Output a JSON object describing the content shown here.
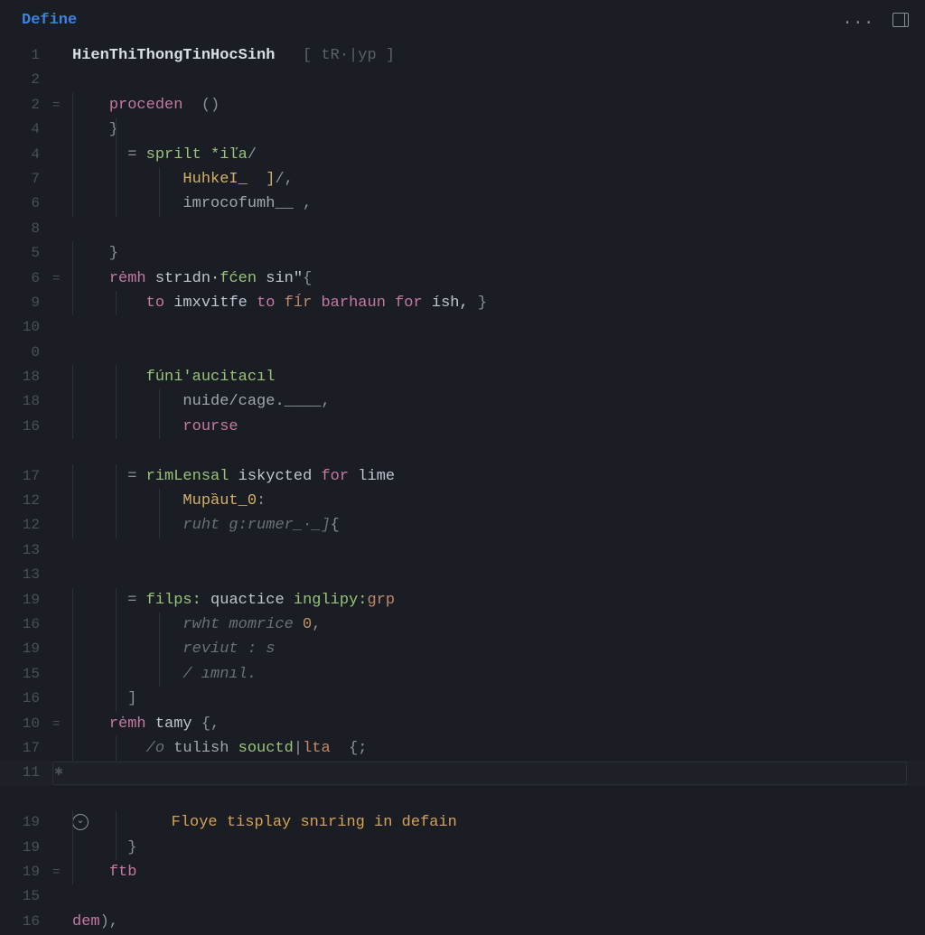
{
  "header": {
    "tab": "Define",
    "more": "...",
    "panel": "panel"
  },
  "lines": [
    {
      "num": "1",
      "fold": "",
      "guides": [],
      "tokens": [
        {
          "cls": "tok-fn",
          "t": "HienThiThongTinHocSinh"
        },
        {
          "cls": "tok-hint",
          "t": "   [ tR·|yp ]"
        }
      ]
    },
    {
      "num": "2",
      "fold": "",
      "guides": [
        "g1"
      ],
      "tokens": []
    },
    {
      "num": "2",
      "fold": "=",
      "guides": [
        "g1"
      ],
      "tokens": [
        {
          "cls": "",
          "t": "    "
        },
        {
          "cls": "tok-kw",
          "t": "proceden"
        },
        {
          "cls": "tok-punc",
          "t": "  ()"
        }
      ]
    },
    {
      "num": "4",
      "fold": "",
      "guides": [
        "g1",
        "g2"
      ],
      "tokens": [
        {
          "cls": "tok-punc",
          "t": "    }"
        }
      ]
    },
    {
      "num": "4",
      "fold": "",
      "guides": [
        "g1",
        "g2"
      ],
      "tokens": [
        {
          "cls": "tok-op",
          "t": "      = "
        },
        {
          "cls": "tok-call",
          "t": "sprilt"
        },
        {
          "cls": "tok-str",
          "t": " *iľa"
        },
        {
          "cls": "tok-punc",
          "t": "/"
        }
      ]
    },
    {
      "num": "7",
      "fold": "",
      "guides": [
        "g1",
        "g2",
        "g3"
      ],
      "tokens": [
        {
          "cls": "",
          "t": "            "
        },
        {
          "cls": "tok-param",
          "t": "HuhkeI_  ]"
        },
        {
          "cls": "tok-punc",
          "t": "/,"
        }
      ]
    },
    {
      "num": "6",
      "fold": "",
      "guides": [
        "g1",
        "g2",
        "g3"
      ],
      "tokens": [
        {
          "cls": "",
          "t": "            "
        },
        {
          "cls": "tok-lit",
          "t": "imrocofumh__"
        },
        {
          "cls": "tok-punc",
          "t": " ,"
        }
      ]
    },
    {
      "num": "8",
      "fold": "",
      "guides": [
        "g1",
        "g2"
      ],
      "tokens": []
    },
    {
      "num": "5",
      "fold": "",
      "guides": [
        "g1"
      ],
      "tokens": [
        {
          "cls": "tok-punc",
          "t": "    }"
        }
      ]
    },
    {
      "num": "6",
      "fold": "=",
      "guides": [
        "g1"
      ],
      "tokens": [
        {
          "cls": "",
          "t": "    "
        },
        {
          "cls": "tok-kw",
          "t": "rėmh"
        },
        {
          "cls": "tok-id",
          "t": " strıdn·"
        },
        {
          "cls": "tok-call",
          "t": "fćen"
        },
        {
          "cls": "tok-id",
          "t": " sin\""
        },
        {
          "cls": "tok-punc",
          "t": "{"
        }
      ]
    },
    {
      "num": "9",
      "fold": "",
      "guides": [
        "g1",
        "g2"
      ],
      "tokens": [
        {
          "cls": "",
          "t": "        "
        },
        {
          "cls": "tok-kw",
          "t": "to"
        },
        {
          "cls": "tok-id",
          "t": " imxvitfe "
        },
        {
          "cls": "tok-kw",
          "t": "to"
        },
        {
          "cls": "tok-id2",
          "t": " fĺr "
        },
        {
          "cls": "tok-kw",
          "t": "barhaun for"
        },
        {
          "cls": "tok-id",
          "t": " ísh, "
        },
        {
          "cls": "tok-punc",
          "t": "}"
        }
      ]
    },
    {
      "num": "10",
      "fold": "",
      "guides": [
        "g1",
        "g2"
      ],
      "tokens": []
    },
    {
      "num": "0",
      "fold": "",
      "guides": [
        "g1",
        "g2"
      ],
      "tokens": []
    },
    {
      "num": "18",
      "fold": "",
      "guides": [
        "g1",
        "g2"
      ],
      "tokens": [
        {
          "cls": "",
          "t": "        "
        },
        {
          "cls": "tok-call",
          "t": "fúni'aucitacıl"
        }
      ]
    },
    {
      "num": "18",
      "fold": "",
      "guides": [
        "g1",
        "g2",
        "g3"
      ],
      "tokens": [
        {
          "cls": "",
          "t": "            "
        },
        {
          "cls": "tok-lit",
          "t": "nuide/cage.____"
        },
        {
          "cls": "tok-punc",
          "t": ","
        }
      ]
    },
    {
      "num": "16",
      "fold": "",
      "guides": [
        "g1",
        "g2",
        "g3"
      ],
      "tokens": [
        {
          "cls": "",
          "t": "            "
        },
        {
          "cls": "tok-kw",
          "t": "rourse"
        }
      ]
    },
    {
      "num": "",
      "fold": "",
      "guides": [
        "g1",
        "g2"
      ],
      "tokens": []
    },
    {
      "num": "17",
      "fold": "",
      "guides": [
        "g1",
        "g2"
      ],
      "tokens": [
        {
          "cls": "tok-op",
          "t": "      = "
        },
        {
          "cls": "tok-call",
          "t": "rimLensal"
        },
        {
          "cls": "tok-id",
          "t": " iskycted "
        },
        {
          "cls": "tok-kw",
          "t": "for"
        },
        {
          "cls": "tok-id",
          "t": " lime"
        }
      ]
    },
    {
      "num": "12",
      "fold": "",
      "guides": [
        "g1",
        "g2",
        "g3"
      ],
      "tokens": [
        {
          "cls": "",
          "t": "            "
        },
        {
          "cls": "tok-param",
          "t": "Mupȁut_0"
        },
        {
          "cls": "tok-punc",
          "t": ":"
        }
      ]
    },
    {
      "num": "12",
      "fold": "",
      "guides": [
        "g1",
        "g2",
        "g3"
      ],
      "tokens": [
        {
          "cls": "",
          "t": "            "
        },
        {
          "cls": "tok-comment",
          "t": "ruht g:rumer_·_]"
        },
        {
          "cls": "tok-punc",
          "t": "{"
        }
      ]
    },
    {
      "num": "13",
      "fold": "",
      "guides": [
        "g1",
        "g2"
      ],
      "tokens": []
    },
    {
      "num": "13",
      "fold": "",
      "guides": [
        "g1",
        "g2"
      ],
      "tokens": []
    },
    {
      "num": "19",
      "fold": "",
      "guides": [
        "g1",
        "g2"
      ],
      "tokens": [
        {
          "cls": "tok-op",
          "t": "      = "
        },
        {
          "cls": "tok-call",
          "t": "filps:"
        },
        {
          "cls": "tok-id",
          "t": " quactice "
        },
        {
          "cls": "tok-call",
          "t": "inglipy:"
        },
        {
          "cls": "tok-id2",
          "t": "grp"
        }
      ]
    },
    {
      "num": "16",
      "fold": "",
      "guides": [
        "g1",
        "g2",
        "g3"
      ],
      "tokens": [
        {
          "cls": "",
          "t": "            "
        },
        {
          "cls": "tok-comment",
          "t": "rwht momrice "
        },
        {
          "cls": "tok-num",
          "t": "0"
        },
        {
          "cls": "tok-punc",
          "t": ","
        }
      ]
    },
    {
      "num": "19",
      "fold": "",
      "guides": [
        "g1",
        "g2",
        "g3"
      ],
      "tokens": [
        {
          "cls": "",
          "t": "            "
        },
        {
          "cls": "tok-comment",
          "t": "reviut : s"
        }
      ]
    },
    {
      "num": "15",
      "fold": "",
      "guides": [
        "g1",
        "g2",
        "g3"
      ],
      "tokens": [
        {
          "cls": "",
          "t": "            "
        },
        {
          "cls": "tok-comment",
          "t": "/ ımnıl."
        }
      ]
    },
    {
      "num": "16",
      "fold": "",
      "guides": [
        "g1",
        "g2"
      ],
      "tokens": [
        {
          "cls": "tok-punc",
          "t": "      ]"
        }
      ]
    },
    {
      "num": "10",
      "fold": "=",
      "guides": [
        "g1"
      ],
      "tokens": [
        {
          "cls": "",
          "t": "    "
        },
        {
          "cls": "tok-kw",
          "t": "rėmh"
        },
        {
          "cls": "tok-id",
          "t": " tamy "
        },
        {
          "cls": "tok-punc",
          "t": "{,"
        }
      ]
    },
    {
      "num": "17",
      "fold": "",
      "guides": [
        "g1",
        "g2"
      ],
      "tokens": [
        {
          "cls": "",
          "t": "        "
        },
        {
          "cls": "tok-comment",
          "t": "/o "
        },
        {
          "cls": "tok-lit",
          "t": "tulish "
        },
        {
          "cls": "tok-str",
          "t": "souctd"
        },
        {
          "cls": "tok-punc",
          "t": "|"
        },
        {
          "cls": "tok-id2",
          "t": "lta  "
        },
        {
          "cls": "tok-punc",
          "t": "{;"
        }
      ]
    },
    {
      "num": "11",
      "fold": "",
      "guides": [
        "g1"
      ],
      "tokens": [],
      "current": true,
      "bp": true
    },
    {
      "num": "",
      "fold": "",
      "guides": [
        "g1"
      ],
      "tokens": []
    },
    {
      "num": "19",
      "fold": "",
      "guides": [
        "g1",
        "g2"
      ],
      "tokens": [
        {
          "cls": "",
          "t": "        "
        },
        {
          "cls": "tok-type",
          "t": "Floye tisplay snıring in defain"
        }
      ],
      "hint": true
    },
    {
      "num": "19",
      "fold": "",
      "guides": [
        "g1",
        "g2"
      ],
      "tokens": [
        {
          "cls": "tok-punc",
          "t": "      }"
        }
      ]
    },
    {
      "num": "19",
      "fold": "=",
      "guides": [
        "g1"
      ],
      "tokens": [
        {
          "cls": "",
          "t": "    "
        },
        {
          "cls": "tok-kw",
          "t": "ftb"
        }
      ]
    },
    {
      "num": "15",
      "fold": "",
      "guides": [],
      "tokens": []
    },
    {
      "num": "16",
      "fold": "",
      "guides": [],
      "tokens": [
        {
          "cls": "tok-kw",
          "t": "dem"
        },
        {
          "cls": "tok-punc",
          "t": "),"
        }
      ]
    }
  ]
}
